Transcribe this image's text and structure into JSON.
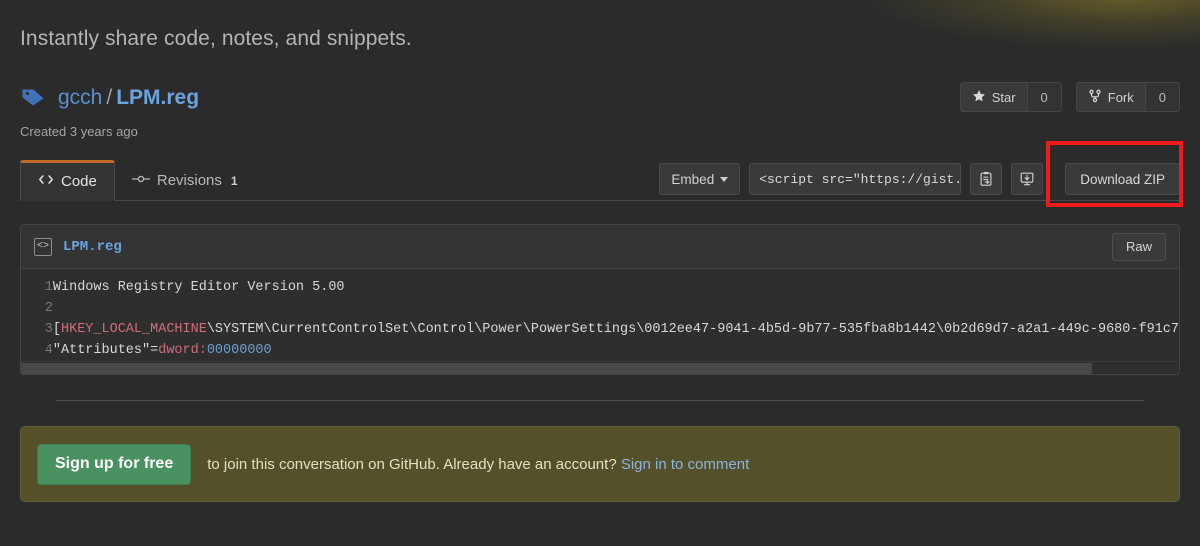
{
  "tagline": "Instantly share code, notes, and snippets.",
  "gist": {
    "tag_icon": "tag-icon",
    "owner": "gcch",
    "separator": "/",
    "filename": "LPM.reg",
    "created": "Created 3 years ago"
  },
  "title_actions": {
    "star": {
      "icon": "star-icon",
      "label": "Star",
      "count": "0"
    },
    "fork": {
      "icon": "fork-icon",
      "label": "Fork",
      "count": "0"
    }
  },
  "tabs": [
    {
      "icon": "code-icon",
      "label": "Code",
      "count": "",
      "active": true
    },
    {
      "icon": "git-commit-icon",
      "label": "Revisions",
      "count": "1",
      "active": false
    }
  ],
  "tab_actions": {
    "embed_label": "Embed",
    "embed_caret": "chevron-down-icon",
    "embed_value": "<script src=\"https://gist.",
    "copy_icon": "clipboard-copy-icon",
    "download_icon": "download-desktop-icon",
    "download_zip_label": "Download ZIP"
  },
  "file": {
    "icon": "file-code-icon",
    "name": "LPM.reg",
    "raw_label": "Raw",
    "lines": [
      {
        "n": "1",
        "text": "Windows Registry Editor Version 5.00"
      },
      {
        "n": "2",
        "text": ""
      },
      {
        "n": "3",
        "text": "[HKEY_LOCAL_MACHINE\\SYSTEM\\CurrentControlSet\\Control\\Power\\PowerSettings\\0012ee47-9041-4b5d-9b77-535fba8b1442\\0b2d69d7-a2a1-449c-9680-f91c7"
      },
      {
        "n": "4",
        "text": "\"Attributes\"=dword:00000000"
      }
    ],
    "line1": "Windows Registry Editor Version 5.00",
    "line3_key": "HKEY_LOCAL_MACHINE",
    "line3_rest": "\\SYSTEM\\CurrentControlSet\\Control\\Power\\PowerSettings\\0012ee47-9041-4b5d-9b77-535fba8b1442\\0b2d69d7-a2a1-449c-9680-f91c7",
    "line4_name": "\"Attributes\"=",
    "line4_type": "dword:",
    "line4_value": "00000000"
  },
  "signup": {
    "button_label": "Sign up for free",
    "text_before": "to join this conversation on GitHub",
    "text_middle": ". Already have an account? ",
    "link_label": "Sign in to comment"
  },
  "annotation": {
    "target": "Download ZIP",
    "color": "#ef1b1b"
  },
  "colors": {
    "page_bg": "#2b2b2b",
    "accent_tab": "#c0692a",
    "link_blue": "#6ba3e0",
    "signup_bg": "#54502a",
    "signup_button": "#4a9162",
    "annotation_red": "#ef1b1b"
  }
}
